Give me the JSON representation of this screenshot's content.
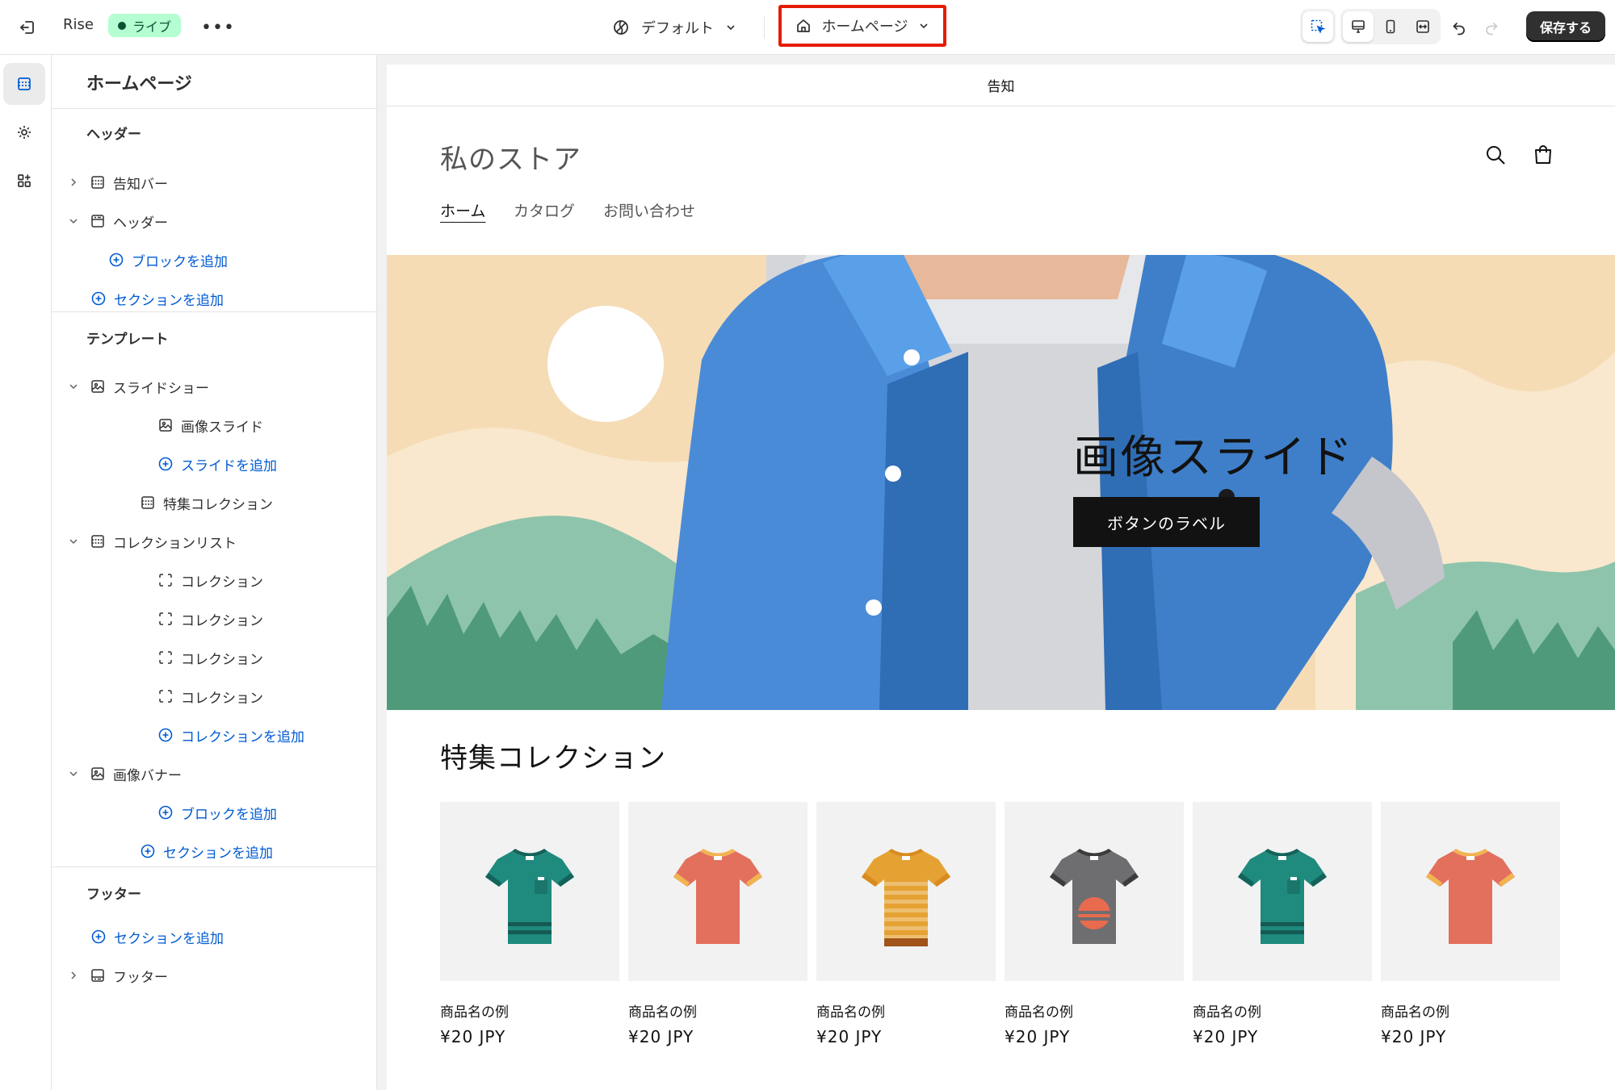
{
  "topbar": {
    "store_name": "Rise",
    "live_label": "ライブ",
    "theme_label": "デフォルト",
    "page_label": "ホームページ",
    "save_label": "保存する"
  },
  "sidebar": {
    "title": "ホームページ",
    "header_group": "ヘッダー",
    "header_items": {
      "announcement_bar": "告知バー",
      "header": "ヘッダー",
      "add_block": "ブロックを追加",
      "add_section": "セクションを追加"
    },
    "template_group": "テンプレート",
    "template_items": {
      "slideshow": "スライドショー",
      "image_slide": "画像スライド",
      "add_slide": "スライドを追加",
      "featured_collection": "特集コレクション",
      "collection_list": "コレクションリスト",
      "collections": [
        "コレクション",
        "コレクション",
        "コレクション",
        "コレクション"
      ],
      "add_collection": "コレクションを追加",
      "image_banner": "画像バナー",
      "add_block": "ブロックを追加",
      "add_section": "セクションを追加"
    },
    "footer_group": "フッター",
    "footer_items": {
      "add_section": "セクションを追加",
      "footer": "フッター"
    }
  },
  "preview": {
    "announcement": "告知",
    "store_logo": "私のストア",
    "nav": [
      "ホーム",
      "カタログ",
      "お問い合わせ"
    ],
    "hero_title": "画像スライド",
    "hero_button": "ボタンのラベル",
    "featured_title": "特集コレクション",
    "products": [
      {
        "name": "商品名の例",
        "price": "¥20 JPY",
        "color": "#1f8a7e",
        "style": "pocket"
      },
      {
        "name": "商品名の例",
        "price": "¥20 JPY",
        "color": "#e2705d",
        "style": "plain"
      },
      {
        "name": "商品名の例",
        "price": "¥20 JPY",
        "color": "#e5a233",
        "style": "stripes"
      },
      {
        "name": "商品名の例",
        "price": "¥20 JPY",
        "color": "#6e6e70",
        "style": "sun"
      },
      {
        "name": "商品名の例",
        "price": "¥20 JPY",
        "color": "#1f8a7e",
        "style": "pocket"
      },
      {
        "name": "商品名の例",
        "price": "¥20 JPY",
        "color": "#e2705d",
        "style": "plain"
      }
    ]
  },
  "colors": {
    "accent_link": "#005bd3",
    "highlight_border": "#e51c00",
    "live_badge_bg": "#b4fed2",
    "save_button_bg": "#303030"
  }
}
